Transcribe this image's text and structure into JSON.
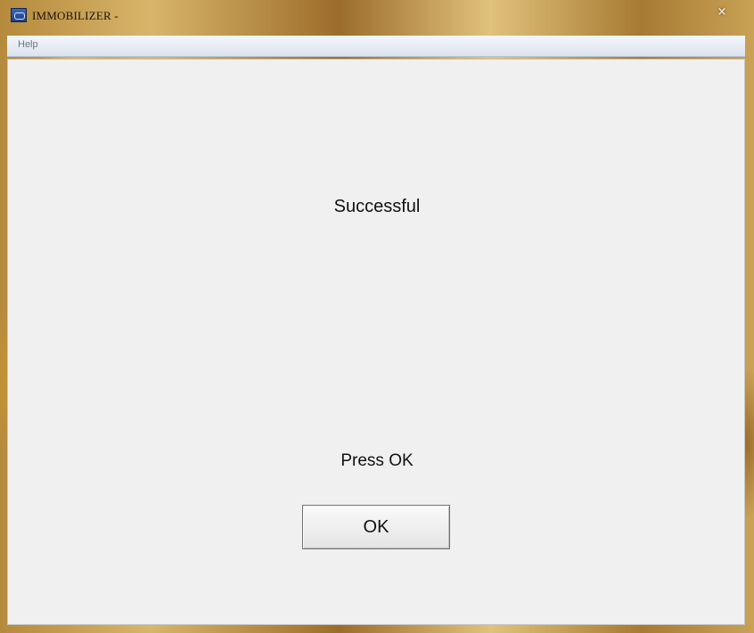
{
  "window": {
    "title": "IMMOBILIZER -",
    "close_glyph": "×",
    "icon": "app-icon"
  },
  "menu": {
    "items": [
      {
        "label": "Help"
      }
    ]
  },
  "dialog": {
    "status": "Successful",
    "prompt": "Press OK",
    "ok_label": "OK"
  },
  "colors": {
    "client_background": "#f0f0f0",
    "text": "#111111"
  }
}
